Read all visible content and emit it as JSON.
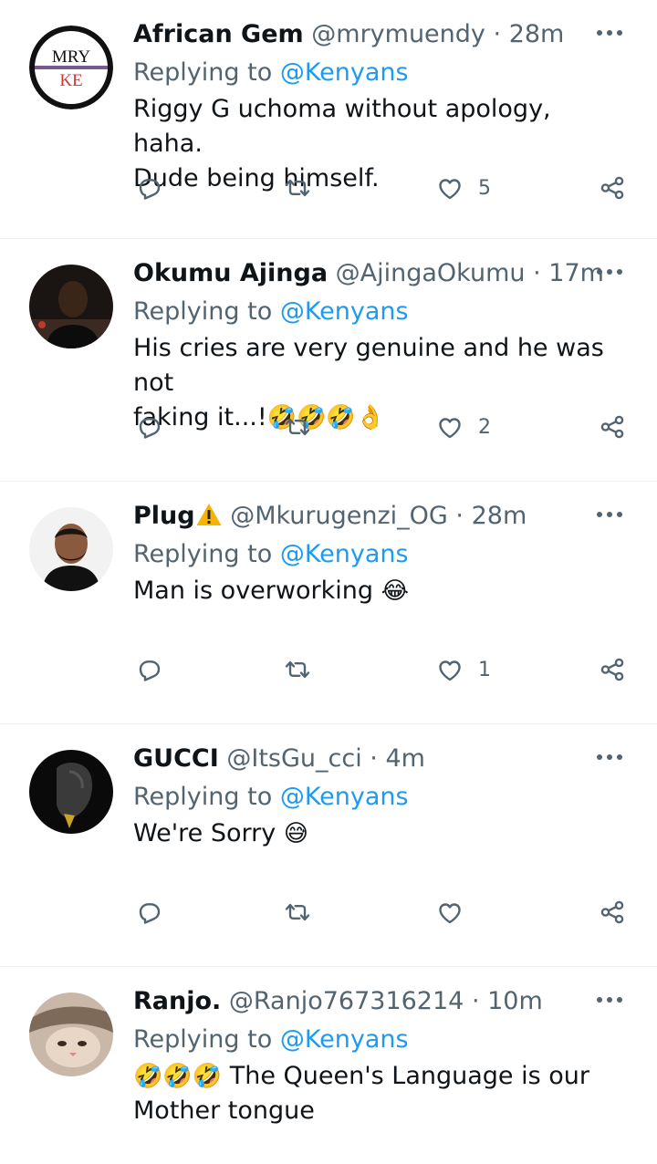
{
  "reply_prefix": "Replying to",
  "tweets": [
    {
      "name": "African Gem",
      "handle": "@mrymuendy",
      "separator": "·",
      "time": "28m",
      "mention": "@Kenyans",
      "text_lines": [
        "Riggy G uchoma without apology, haha.",
        "Dude being himself."
      ],
      "likes": "5",
      "avatar_icon": "mry-ke-logo-avatar",
      "avatar_text_top": "MRY",
      "avatar_text_bottom": "KE"
    },
    {
      "name": "Okumu Ajinga",
      "handle": "@AjingaOkumu",
      "separator": "·",
      "time": "17m",
      "mention": "@Kenyans",
      "text_lines": [
        "His cries are very genuine and he was not",
        "faking it...!"
      ],
      "text_emoji": "🤣🤣🤣👌",
      "likes": "2",
      "avatar_icon": "person-photo-avatar"
    },
    {
      "name": "Plug",
      "name_badge": "warning-emoji",
      "handle": "@Mkurugenzi_OG",
      "separator": "·",
      "time": "28m",
      "mention": "@Kenyans",
      "text": "Man is overworking",
      "text_emoji": "😂",
      "likes": "1",
      "avatar_icon": "person-photo-avatar"
    },
    {
      "name": "GUCCI",
      "handle": "@ItsGu_cci",
      "separator": "·",
      "time": "4m",
      "mention": "@Kenyans",
      "text": "We're Sorry",
      "text_emoji": "😅",
      "likes": "",
      "avatar_icon": "person-photo-avatar"
    },
    {
      "name": "Ranjo.",
      "handle": "@Ranjo767316214",
      "separator": "·",
      "time": "10m",
      "mention": "@Kenyans",
      "text_emoji": "🤣🤣🤣",
      "text_lines": [
        " The Queen's Language is our",
        "Mother tongue"
      ],
      "avatar_icon": "cat-photo-avatar"
    }
  ],
  "colors": {
    "text": "#0f1419",
    "secondary": "#536471",
    "link": "#1d9bf0",
    "divider": "#eff3f4"
  },
  "icons": [
    "reply-icon",
    "retweet-icon",
    "like-icon",
    "share-icon",
    "more-icon"
  ]
}
